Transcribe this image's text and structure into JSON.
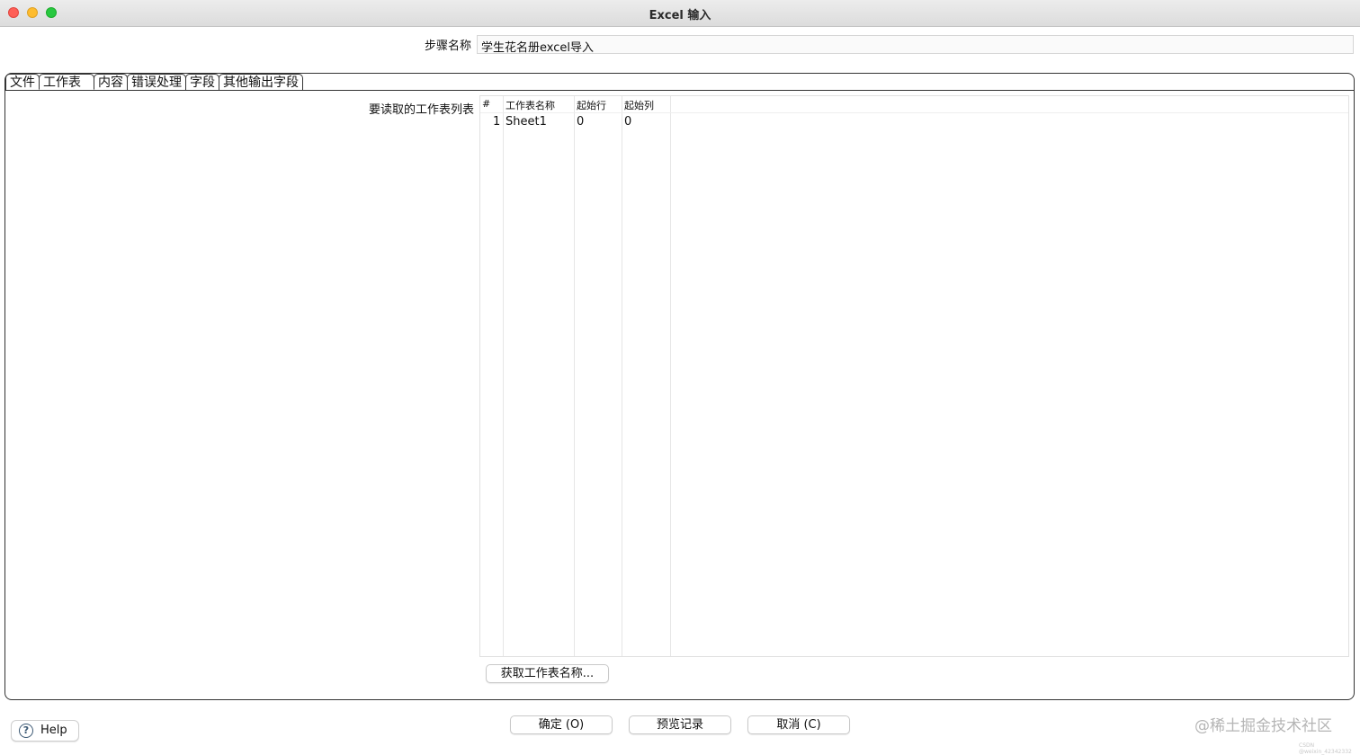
{
  "window": {
    "title": "Excel 输入"
  },
  "step": {
    "label": "步骤名称",
    "value": "学生花名册excel导入"
  },
  "tabs": [
    {
      "label": "文件"
    },
    {
      "label": "工作表"
    },
    {
      "label": "内容"
    },
    {
      "label": "错误处理"
    },
    {
      "label": "字段"
    },
    {
      "label": "其他输出字段"
    }
  ],
  "active_tab": "工作表",
  "sheet_list": {
    "label": "要读取的工作表列表",
    "columns": [
      "#",
      "工作表名称",
      "起始行",
      "起始列"
    ],
    "rows": [
      {
        "num": "1",
        "name": "Sheet1",
        "start_row": "0",
        "start_col": "0"
      }
    ],
    "get_names_button": "获取工作表名称..."
  },
  "footer": {
    "help": "Help",
    "ok": "确定 (O)",
    "preview": "预览记录",
    "cancel": "取消 (C)"
  },
  "watermark": "@稀土掘金技术社区",
  "watermark_small": "CSDN @weixin_42342332"
}
